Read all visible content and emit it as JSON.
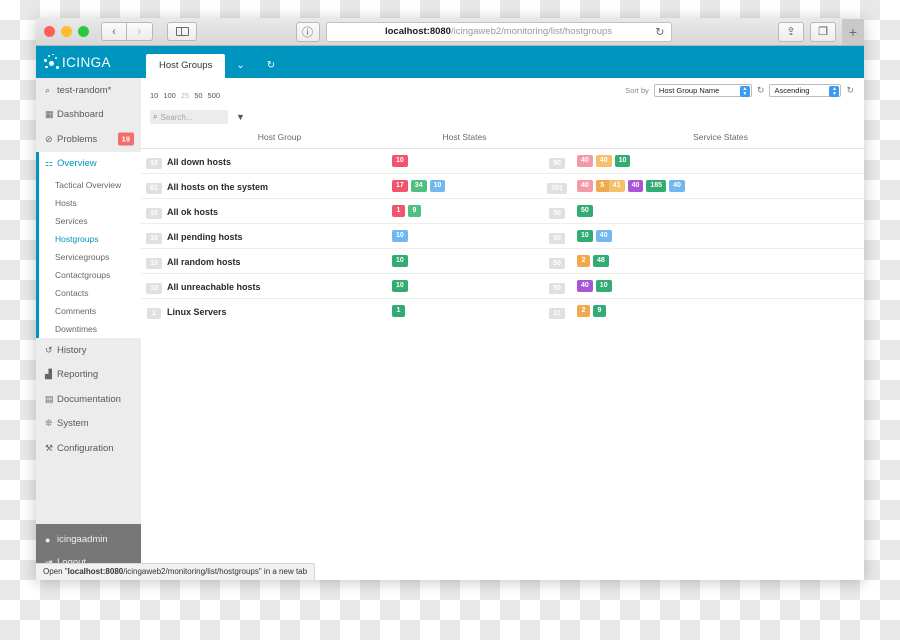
{
  "browser": {
    "back_label": "‹",
    "forward_label": "›",
    "sidebar_icon": "sidebar-icon",
    "reader_icon": "reader-view-icon",
    "url_host": "localhost:8080",
    "url_path": "/icingaweb2/monitoring/list/hostgroups",
    "reload_icon": "↻",
    "share_icon": "⇪",
    "tabs_icon": "❐",
    "newtab_label": "+"
  },
  "sidebar": {
    "logo_text": "ICINGA",
    "top_items": [
      {
        "icon": "search-icon",
        "glyph": "⌕",
        "label": "test-random*",
        "badge": null,
        "active": false
      },
      {
        "icon": "dashboard-icon",
        "glyph": "▦",
        "label": "Dashboard",
        "badge": null,
        "active": false
      },
      {
        "icon": "problems-icon",
        "glyph": "⊘",
        "label": "Problems",
        "badge": "19",
        "active": false
      }
    ],
    "overview": {
      "icon": "overview-icon",
      "glyph": "⚏",
      "label": "Overview"
    },
    "submenu": [
      {
        "label": "Tactical Overview",
        "active": false
      },
      {
        "label": "Hosts",
        "active": false
      },
      {
        "label": "Services",
        "active": false
      },
      {
        "label": "Hostgroups",
        "active": true
      },
      {
        "label": "Servicegroups",
        "active": false
      },
      {
        "label": "Contactgroups",
        "active": false
      },
      {
        "label": "Contacts",
        "active": false
      },
      {
        "label": "Comments",
        "active": false
      },
      {
        "label": "Downtimes",
        "active": false
      }
    ],
    "lower_items": [
      {
        "icon": "history-icon",
        "glyph": "↺",
        "label": "History"
      },
      {
        "icon": "reporting-icon",
        "glyph": "▟",
        "label": "Reporting"
      },
      {
        "icon": "documentation-icon",
        "glyph": "▤",
        "label": "Documentation"
      },
      {
        "icon": "system-icon",
        "glyph": "❊",
        "label": "System"
      },
      {
        "icon": "configuration-icon",
        "glyph": "⚒",
        "label": "Configuration"
      }
    ],
    "footer_items": [
      {
        "icon": "user-icon",
        "glyph": "👤",
        "label": "icingaadmin"
      },
      {
        "icon": "logout-icon",
        "glyph": "⇥",
        "label": "Logout"
      }
    ]
  },
  "tabbar": {
    "tab_label": "Host Groups",
    "dropdown_icon": "chevron-down-icon",
    "dropdown_glyph": "⌄",
    "refresh_icon": "refresh-icon",
    "refresh_glyph": "↻"
  },
  "toolbar": {
    "page_sizes": [
      "10",
      "100",
      "25",
      "50",
      "500"
    ],
    "current_page_size": "25",
    "sort_by_label": "Sort by",
    "sort_field_value": "Host Group Name",
    "sort_dir_value": "Ascending",
    "refresh_glyph": "↻"
  },
  "search": {
    "placeholder": "Search...",
    "value": "",
    "search_icon": "search-icon",
    "search_glyph": "⌕",
    "filter_icon": "filter-icon",
    "filter_glyph": "▼"
  },
  "table": {
    "headers": {
      "host_group": "Host Group",
      "host_states": "Host States",
      "service_states": "Service States"
    },
    "rows": [
      {
        "count": "10",
        "name": "All down hosts",
        "host_states": [
          {
            "value": "10",
            "color": "#f2556b"
          }
        ],
        "service_total": "90",
        "service_states": [
          {
            "value": "40",
            "color": "#f599a8"
          },
          {
            "value": "40",
            "color": "#f5c06a"
          },
          {
            "value": "10",
            "color": "#31ac72"
          }
        ]
      },
      {
        "count": "61",
        "name": "All hosts on the system",
        "host_states": [
          {
            "value": "17",
            "color": "#f2556b"
          },
          {
            "value": "34",
            "color": "#4ec07f"
          },
          {
            "value": "10",
            "color": "#72b7f0"
          }
        ],
        "service_total": "351",
        "service_states": [
          {
            "value": "40",
            "color": "#f599a8"
          },
          {
            "group": [
              {
                "value": "5",
                "color": "#f0a94e"
              },
              {
                "value": "41",
                "color": "#f5c06a"
              }
            ]
          },
          {
            "value": "40",
            "color": "#a855d6"
          },
          {
            "value": "185",
            "color": "#31ac72"
          },
          {
            "value": "40",
            "color": "#72b7f0"
          }
        ]
      },
      {
        "count": "10",
        "name": "All ok hosts",
        "host_states": [
          {
            "value": "1",
            "color": "#f2556b"
          },
          {
            "value": "9",
            "color": "#4ec07f"
          }
        ],
        "service_total": "50",
        "service_states": [
          {
            "value": "50",
            "color": "#31ac72"
          }
        ]
      },
      {
        "count": "10",
        "name": "All pending hosts",
        "host_states": [
          {
            "value": "10",
            "color": "#72b7f0"
          }
        ],
        "service_total": "50",
        "service_states": [
          {
            "value": "10",
            "color": "#31ac72"
          },
          {
            "value": "40",
            "color": "#72b7f0"
          }
        ]
      },
      {
        "count": "10",
        "name": "All random hosts",
        "host_states": [
          {
            "value": "10",
            "color": "#31ac72"
          }
        ],
        "service_total": "50",
        "service_states": [
          {
            "value": "2",
            "color": "#f0a94e"
          },
          {
            "value": "48",
            "color": "#31ac72"
          }
        ]
      },
      {
        "count": "10",
        "name": "All unreachable hosts",
        "host_states": [
          {
            "value": "10",
            "color": "#31ac72"
          }
        ],
        "service_total": "50",
        "service_states": [
          {
            "value": "40",
            "color": "#a855d6"
          },
          {
            "value": "10",
            "color": "#31ac72"
          }
        ]
      },
      {
        "count": "1",
        "name": "Linux Servers",
        "host_states": [
          {
            "value": "1",
            "color": "#31ac72"
          }
        ],
        "service_total": "11",
        "service_states": [
          {
            "value": "2",
            "color": "#f0a94e"
          },
          {
            "value": "9",
            "color": "#31ac72"
          }
        ]
      }
    ]
  },
  "statusbar": {
    "prefix": "Open \"",
    "host": "localhost:8080",
    "path": "/icingaweb2/monitoring/list/hostgroups",
    "suffix": "\" in a new tab"
  },
  "colors": {
    "brand": "#0095bf",
    "badge_red": "#f26d6d",
    "sidebar_bg": "#e9e9e9",
    "footer_bg": "#777777"
  }
}
